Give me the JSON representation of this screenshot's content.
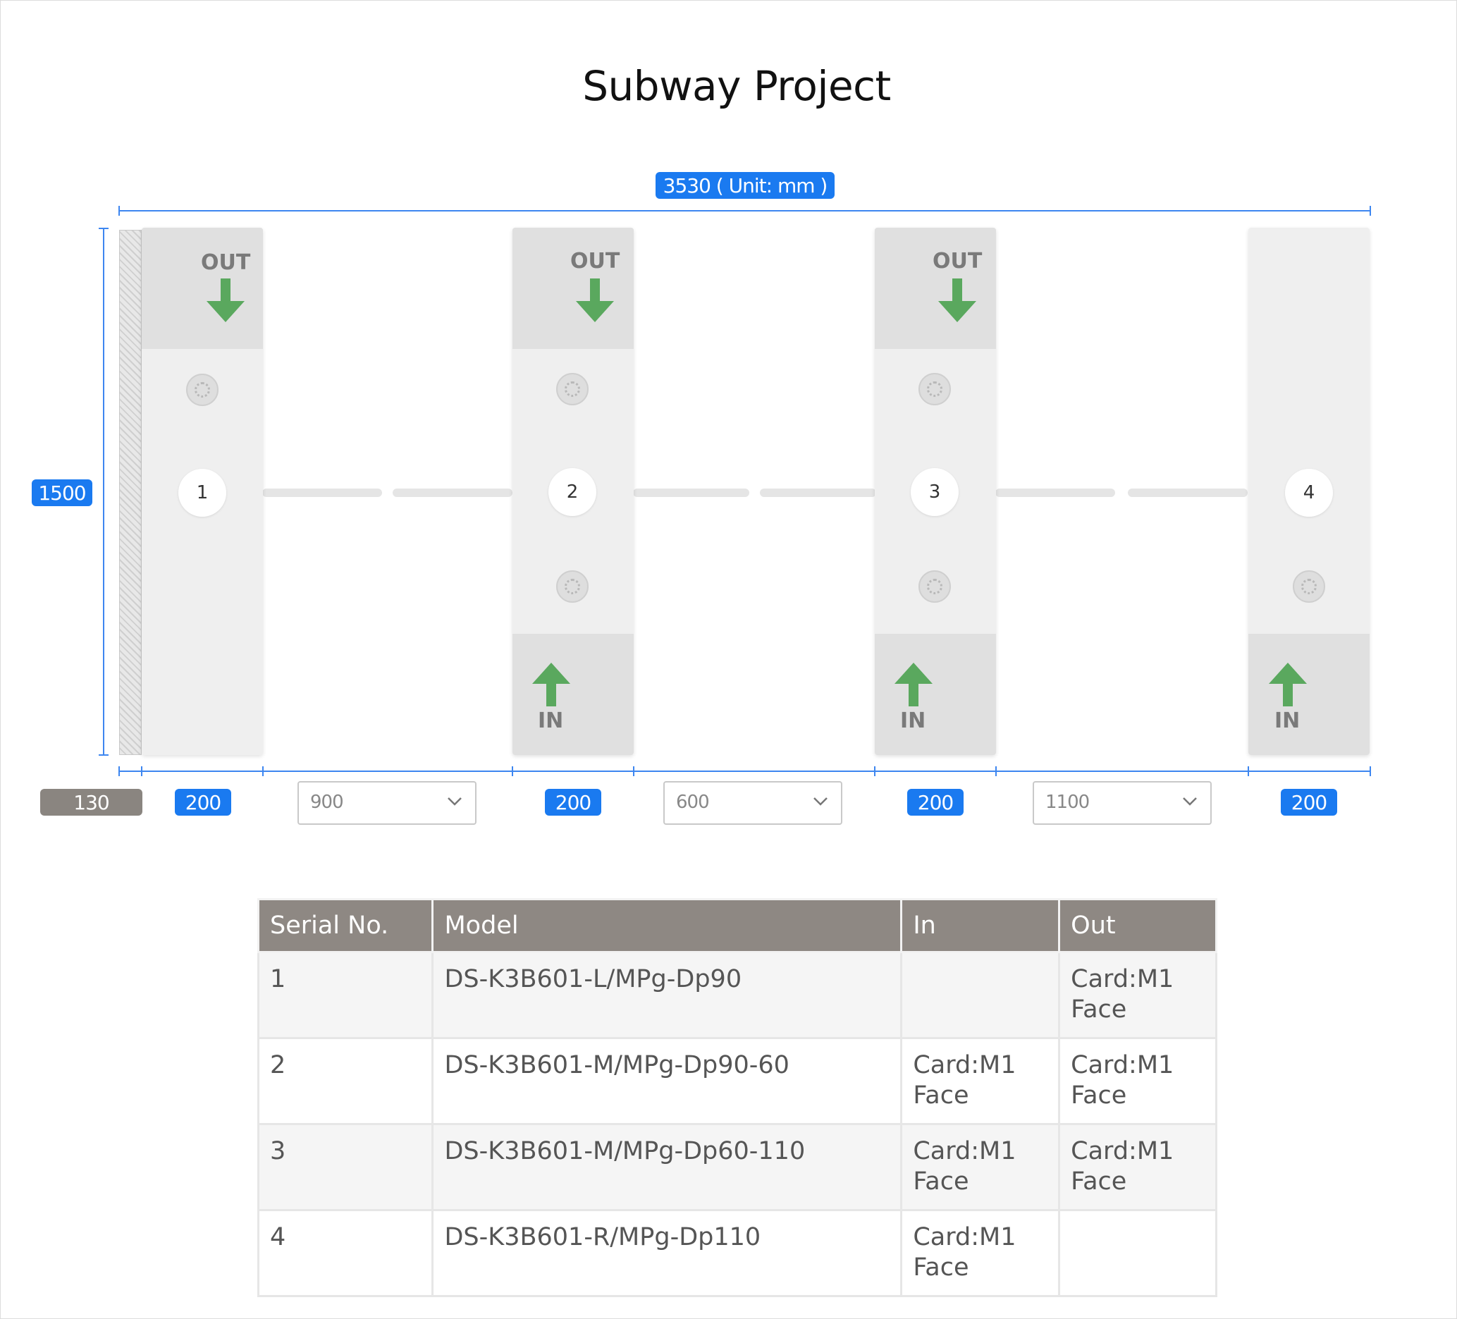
{
  "title": "Subway Project",
  "total_dimension": "3530 ( Unit: mm )",
  "height_dimension": "1500",
  "wall_width": "130",
  "post_width_labels": [
    "200",
    "200",
    "200",
    "200"
  ],
  "posts": [
    {
      "number": "1",
      "out_label": "OUT",
      "in_label": ""
    },
    {
      "number": "2",
      "out_label": "OUT",
      "in_label": "IN"
    },
    {
      "number": "3",
      "out_label": "OUT",
      "in_label": "IN"
    },
    {
      "number": "4",
      "out_label": "",
      "in_label": "IN"
    }
  ],
  "lane_widths": [
    {
      "value": "900"
    },
    {
      "value": "600"
    },
    {
      "value": "1100"
    }
  ],
  "colors": {
    "accent": "#1a7af0",
    "arrow": "#5aa85e",
    "table_header": "#8e8883"
  },
  "table": {
    "headers": [
      "Serial No.",
      "Model",
      "In",
      "Out"
    ],
    "rows": [
      {
        "serial": "1",
        "model": "DS-K3B601-L/MPg-Dp90",
        "in_1": "",
        "in_2": "",
        "out_1": "Card:M1",
        "out_2": "Face"
      },
      {
        "serial": "2",
        "model": "DS-K3B601-M/MPg-Dp90-60",
        "in_1": "Card:M1",
        "in_2": "Face",
        "out_1": "Card:M1",
        "out_2": "Face"
      },
      {
        "serial": "3",
        "model": "DS-K3B601-M/MPg-Dp60-110",
        "in_1": "Card:M1",
        "in_2": "Face",
        "out_1": "Card:M1",
        "out_2": "Face"
      },
      {
        "serial": "4",
        "model": "DS-K3B601-R/MPg-Dp110",
        "in_1": "Card:M1",
        "in_2": "Face",
        "out_1": "",
        "out_2": ""
      }
    ]
  }
}
